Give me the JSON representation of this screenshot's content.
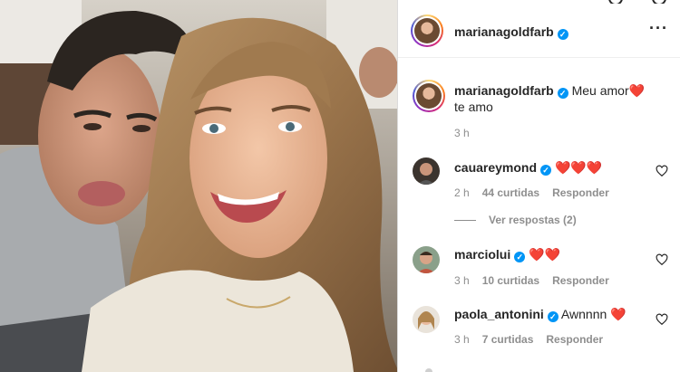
{
  "post": {
    "author": "marianagoldfarb",
    "verified": true,
    "photo_alt": "Selfie of a smiling woman with long wavy hair next to a man making a kissing face",
    "caption": {
      "username": "marianagoldfarb",
      "text_before_heart": "Meu amor",
      "heart_icon": "red-heart",
      "text_after_heart": "te amo",
      "time": "3 h"
    }
  },
  "comments": [
    {
      "username": "cauareymond",
      "verified": true,
      "text": "❤️❤️❤️",
      "time": "2 h",
      "likes": "44 curtidas",
      "reply_label": "Responder",
      "view_replies": "Ver respostas (2)"
    },
    {
      "username": "marciolui",
      "verified": true,
      "text": "❤️❤️",
      "time": "3 h",
      "likes": "10 curtidas",
      "reply_label": "Responder"
    },
    {
      "username": "paola_antonini",
      "verified": true,
      "text": "Awnnnn ❤️",
      "time": "3 h",
      "likes": "7 curtidas",
      "reply_label": "Responder"
    }
  ],
  "icons": {
    "more": "more-options-icon",
    "like": "heart-outline-icon",
    "verified": "verified-badge-icon"
  },
  "colors": {
    "verified_blue": "#0095f6",
    "heart_red": "#ed4956",
    "muted_text": "#8e8e8e",
    "primary_text": "#262626"
  }
}
